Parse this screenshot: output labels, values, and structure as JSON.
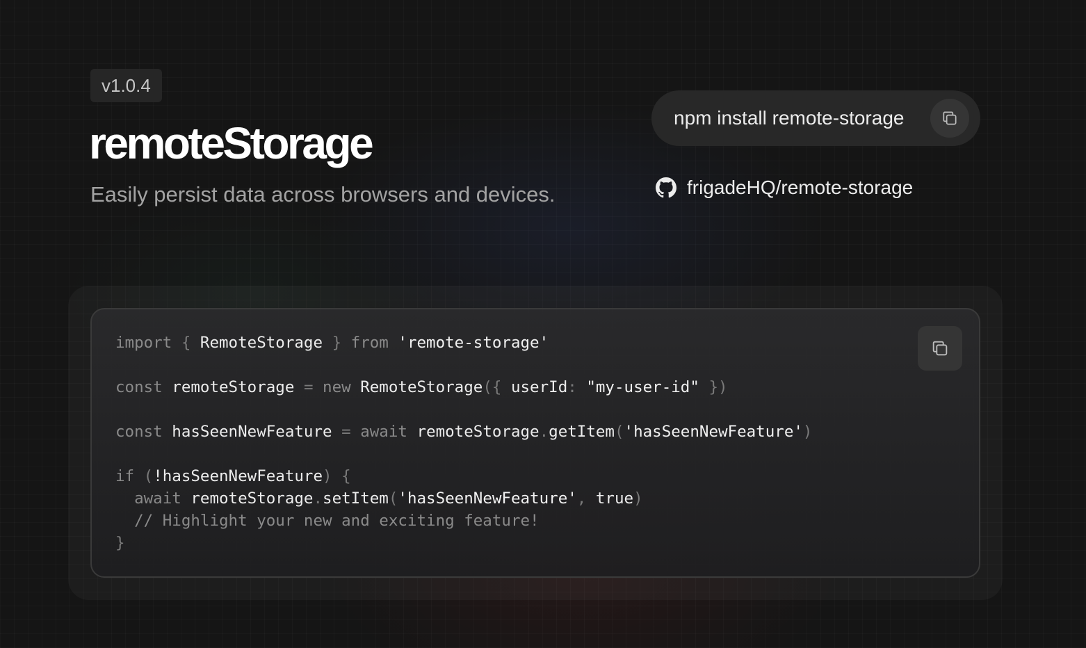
{
  "header": {
    "version": "v1.0.4",
    "title": "remoteStorage",
    "subtitle": "Easily persist data across browsers and devices."
  },
  "install": {
    "command": "npm install remote-storage",
    "copy_icon": "copy-icon"
  },
  "repo": {
    "icon": "github-icon",
    "label": "frigadeHQ/remote-storage"
  },
  "code": {
    "copy_icon": "copy-icon",
    "lines": [
      [
        {
          "t": "import ",
          "c": "k"
        },
        {
          "t": "{ ",
          "c": "p"
        },
        {
          "t": "RemoteStorage ",
          "c": "n"
        },
        {
          "t": "} ",
          "c": "p"
        },
        {
          "t": "from ",
          "c": "k"
        },
        {
          "t": "'remote-storage'",
          "c": "s"
        }
      ],
      [],
      [
        {
          "t": "const ",
          "c": "k"
        },
        {
          "t": "remoteStorage ",
          "c": "n"
        },
        {
          "t": "= ",
          "c": "p"
        },
        {
          "t": "new ",
          "c": "k"
        },
        {
          "t": "RemoteStorage",
          "c": "n"
        },
        {
          "t": "({ ",
          "c": "p"
        },
        {
          "t": "userId",
          "c": "n"
        },
        {
          "t": ": ",
          "c": "p"
        },
        {
          "t": "\"my-user-id\"",
          "c": "s"
        },
        {
          "t": " })",
          "c": "p"
        }
      ],
      [],
      [
        {
          "t": "const ",
          "c": "k"
        },
        {
          "t": "hasSeenNewFeature ",
          "c": "n"
        },
        {
          "t": "= ",
          "c": "p"
        },
        {
          "t": "await ",
          "c": "k"
        },
        {
          "t": "remoteStorage",
          "c": "n"
        },
        {
          "t": ".",
          "c": "p"
        },
        {
          "t": "getItem",
          "c": "n"
        },
        {
          "t": "(",
          "c": "p"
        },
        {
          "t": "'hasSeenNewFeature'",
          "c": "s"
        },
        {
          "t": ")",
          "c": "p"
        }
      ],
      [],
      [
        {
          "t": "if ",
          "c": "k"
        },
        {
          "t": "(",
          "c": "p"
        },
        {
          "t": "!",
          "c": "n"
        },
        {
          "t": "hasSeenNewFeature",
          "c": "n"
        },
        {
          "t": ") {",
          "c": "p"
        }
      ],
      [
        {
          "t": "  await ",
          "c": "k"
        },
        {
          "t": "remoteStorage",
          "c": "n"
        },
        {
          "t": ".",
          "c": "p"
        },
        {
          "t": "setItem",
          "c": "n"
        },
        {
          "t": "(",
          "c": "p"
        },
        {
          "t": "'hasSeenNewFeature'",
          "c": "s"
        },
        {
          "t": ", ",
          "c": "p"
        },
        {
          "t": "true",
          "c": "n"
        },
        {
          "t": ")",
          "c": "p"
        }
      ],
      [
        {
          "t": "  // Highlight your new and exciting feature!",
          "c": "c"
        }
      ],
      [
        {
          "t": "}",
          "c": "p"
        }
      ]
    ]
  }
}
